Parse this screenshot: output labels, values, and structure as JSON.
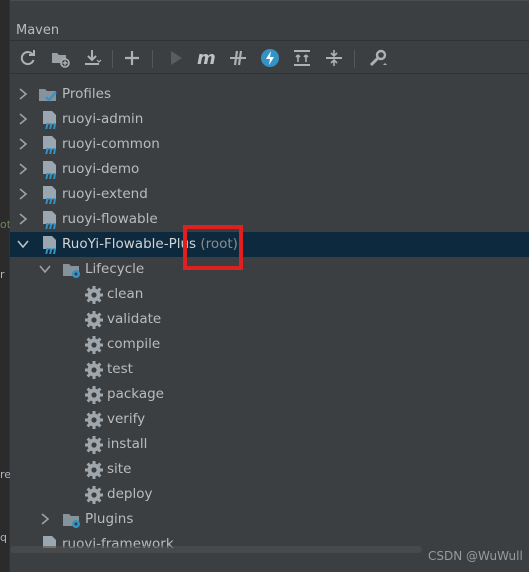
{
  "panel": {
    "title": "Maven"
  },
  "left_strip": {
    "fragments": [
      "ot",
      "r",
      "re",
      "q"
    ]
  },
  "toolbar": {
    "buttons": [
      {
        "name": "reload-icon"
      },
      {
        "name": "folder-add-icon"
      },
      {
        "name": "download-icon"
      },
      {
        "name": "plus-icon"
      },
      {
        "name": "run-icon"
      },
      {
        "name": "execute-goal-icon"
      },
      {
        "name": "toggle-offline-icon"
      },
      {
        "name": "skip-tests-icon"
      },
      {
        "name": "show-dependencies-icon"
      },
      {
        "name": "collapse-all-icon"
      },
      {
        "name": "settings-wrench-icon"
      }
    ]
  },
  "tree": {
    "profiles": "Profiles",
    "modules": [
      "ruoyi-admin",
      "ruoyi-common",
      "ruoyi-demo",
      "ruoyi-extend",
      "ruoyi-flowable"
    ],
    "root": {
      "name": "RuoYi-Flowable-Plus",
      "tag": "(root)"
    },
    "lifecycle": "Lifecycle",
    "phases": [
      "clean",
      "validate",
      "compile",
      "test",
      "package",
      "verify",
      "install",
      "site",
      "deploy"
    ],
    "plugins": "Plugins",
    "next_module": "ruoyi-framework"
  },
  "colors": {
    "accent": "#3592c4",
    "selection": "#0d293e",
    "highlight_box": "#e02020"
  },
  "watermark": "CSDN @WuWull"
}
